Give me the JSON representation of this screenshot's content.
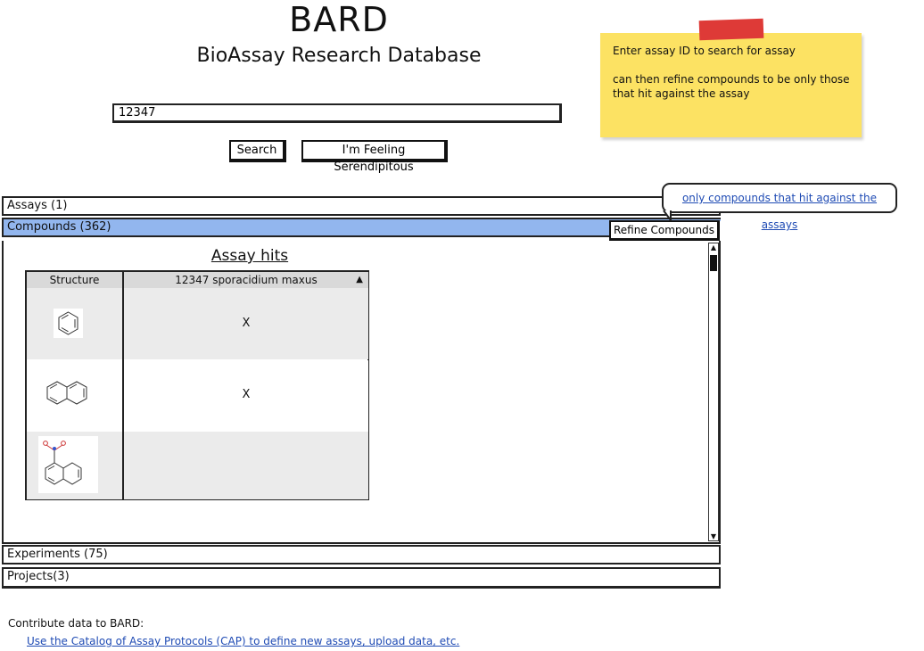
{
  "header": {
    "title": "BARD",
    "subtitle": "BioAssay Research Database"
  },
  "search": {
    "value": "12347",
    "search_label": "Search",
    "serendipity_label": "I'm Feeling Serendipitous"
  },
  "note": {
    "line1": "Enter assay ID to search for assay",
    "line2": "can then refine compounds to be only those that hit against the assay"
  },
  "callout": {
    "text": "only compounds that hit against the assays"
  },
  "sections": {
    "assays": "Assays (1)",
    "compounds": "Compounds (362)",
    "experiments": "Experiments (75)",
    "projects": "Projects(3)"
  },
  "refine_label": "Refine Compounds",
  "table": {
    "title": "Assay hits",
    "columns": [
      "Structure",
      "12347 sporacidium maxus"
    ],
    "sort_indicator": "▲",
    "rows": [
      {
        "structure": "benzene-icon",
        "hit": "X"
      },
      {
        "structure": "naphthalene-icon",
        "hit": "X"
      },
      {
        "structure": "nitronaphthalene-icon",
        "hit": ""
      }
    ]
  },
  "footer": {
    "label": "Contribute data to BARD:",
    "link": "Use the Catalog of Assay Protocols (CAP) to define new assays, upload data, etc."
  },
  "colors": {
    "accent": "#92b6ee",
    "note": "#fce263",
    "tape": "#de3a37",
    "link": "#1f4bb4"
  }
}
